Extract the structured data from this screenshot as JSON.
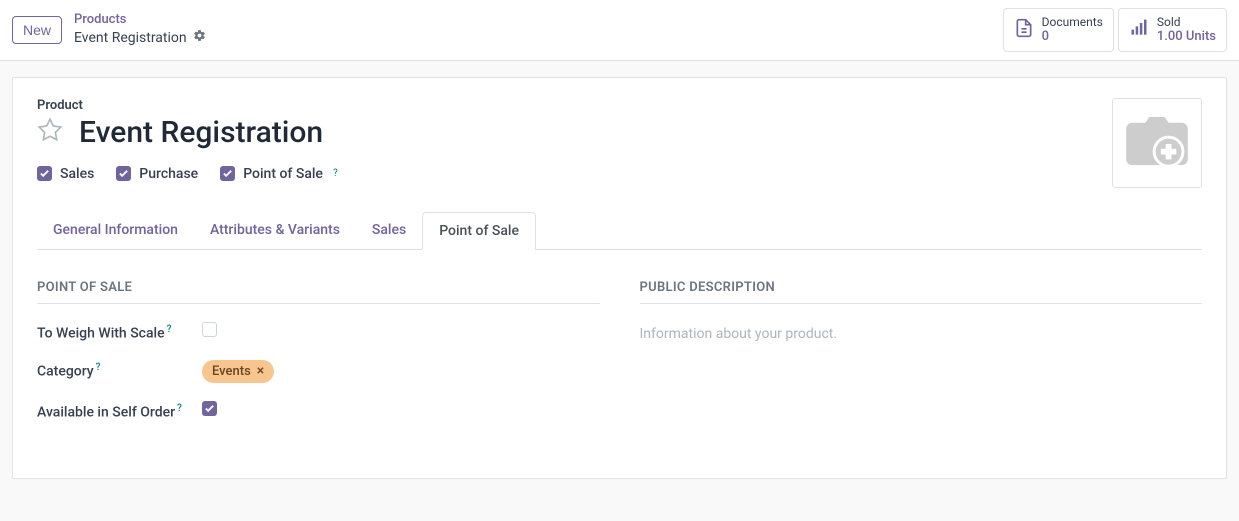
{
  "header": {
    "new_btn": "New",
    "breadcrumb_parent": "Products",
    "breadcrumb_current": "Event Registration",
    "stats": {
      "documents": {
        "label": "Documents",
        "value": "0"
      },
      "sold": {
        "label": "Sold",
        "value": "1.00 Units"
      }
    }
  },
  "product": {
    "small_label": "Product",
    "name": "Event Registration",
    "checks": {
      "sales": "Sales",
      "purchase": "Purchase",
      "pos": "Point of Sale"
    }
  },
  "tabs": {
    "general": "General Information",
    "attributes": "Attributes & Variants",
    "sales": "Sales",
    "pos": "Point of Sale"
  },
  "pos_section": {
    "title": "POINT OF SALE",
    "fields": {
      "weigh": "To Weigh With Scale",
      "category": "Category",
      "self_order": "Available in Self Order"
    },
    "category_tag": "Events"
  },
  "public_desc": {
    "title": "PUBLIC DESCRIPTION",
    "placeholder": "Information about your product."
  },
  "help_char": "?"
}
